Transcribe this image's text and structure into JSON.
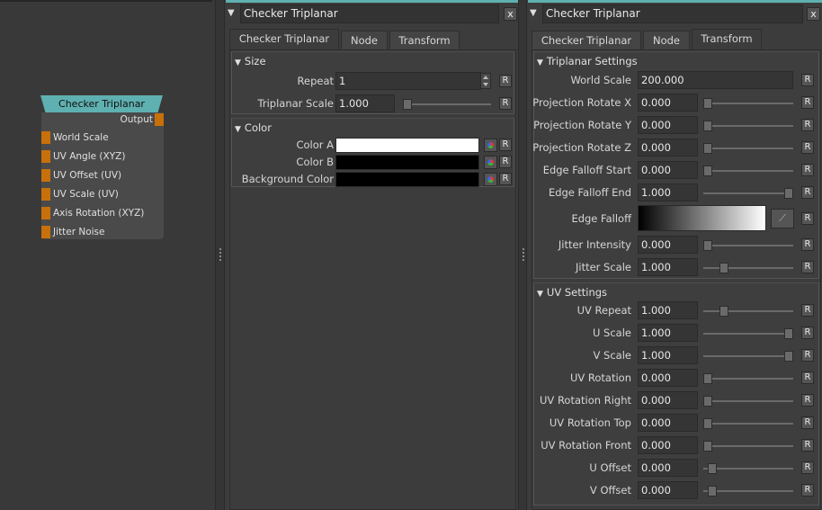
{
  "node": {
    "title": "Checker Triplanar",
    "output_label": "Output",
    "inputs": [
      "World Scale",
      "UV Angle (XYZ)",
      "UV Offset (UV)",
      "UV Scale (UV)",
      "Axis Rotation (XYZ)",
      "Jitter Noise"
    ]
  },
  "panel1": {
    "title": "Checker Triplanar",
    "close": "x",
    "tabs": [
      "Checker Triplanar",
      "Node",
      "Transform"
    ],
    "active_tab": 0,
    "size_section": {
      "title": "Size",
      "repeat_label": "Repeat",
      "repeat_value": "1",
      "tri_scale_label": "Triplanar Scale",
      "tri_scale_value": "1.000"
    },
    "color_section": {
      "title": "Color",
      "rows": [
        {
          "label": "Color A",
          "color": "#ffffff"
        },
        {
          "label": "Color B",
          "color": "#000000"
        },
        {
          "label": "Background Color",
          "color": "#000000"
        }
      ]
    }
  },
  "panel2": {
    "title": "Checker Triplanar",
    "close": "x",
    "tabs": [
      "Checker Triplanar",
      "Node",
      "Transform"
    ],
    "active_tab": 2,
    "triplanar_section": {
      "title": "Triplanar Settings",
      "world_scale_label": "World Scale",
      "world_scale_value": "200.000",
      "rows": [
        {
          "label": "Projection Rotate X",
          "value": "0.000",
          "slider": 0.0
        },
        {
          "label": "Projection Rotate Y",
          "value": "0.000",
          "slider": 0.0
        },
        {
          "label": "Projection Rotate Z",
          "value": "0.000",
          "slider": 0.0
        },
        {
          "label": "Edge Falloff Start",
          "value": "0.000",
          "slider": 0.0
        },
        {
          "label": "Edge Falloff End",
          "value": "1.000",
          "slider": 1.0
        }
      ],
      "edge_falloff_label": "Edge Falloff",
      "rows2": [
        {
          "label": "Jitter Intensity",
          "value": "0.000",
          "slider": 0.0
        },
        {
          "label": "Jitter Scale",
          "value": "1.000",
          "slider": 0.2
        }
      ]
    },
    "uv_section": {
      "title": "UV Settings",
      "rows": [
        {
          "label": "UV Repeat",
          "value": "1.000",
          "slider": 0.2
        },
        {
          "label": "U Scale",
          "value": "1.000",
          "slider": 1.0
        },
        {
          "label": "V Scale",
          "value": "1.000",
          "slider": 1.0
        },
        {
          "label": "UV Rotation",
          "value": "0.000",
          "slider": 0.0
        },
        {
          "label": "UV Rotation Right",
          "value": "0.000",
          "slider": 0.0
        },
        {
          "label": "UV Rotation Top",
          "value": "0.000",
          "slider": 0.0
        },
        {
          "label": "UV Rotation Front",
          "value": "0.000",
          "slider": 0.0
        },
        {
          "label": "U Offset",
          "value": "0.000",
          "slider": 0.05
        },
        {
          "label": "V Offset",
          "value": "0.000",
          "slider": 0.05
        }
      ]
    },
    "reset_label": "R"
  },
  "colors": {
    "accent": "#5fb0b0",
    "port": "#c8700a"
  }
}
